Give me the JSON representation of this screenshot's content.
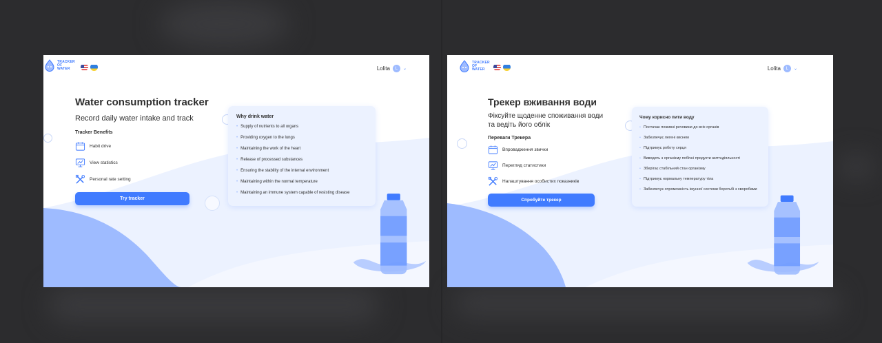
{
  "left_card": {
    "logo": {
      "line1": "TRACKER",
      "line2": "OF WATER"
    },
    "user": {
      "name": "Lolita",
      "avatar_initial": "L"
    },
    "title": "Water consumption tracker",
    "subtitle": "Record daily water intake and track",
    "benefits_title": "Tracker Benefits",
    "benefits": [
      {
        "label": "Habit drive",
        "icon": "calendar-icon"
      },
      {
        "label": "View statistics",
        "icon": "statistics-icon"
      },
      {
        "label": "Personal rate setting",
        "icon": "tools-icon"
      }
    ],
    "button": "Try tracker",
    "panel": {
      "title": "Why drink water",
      "items": [
        "Supply of nutrients to all organs",
        "Providing oxygen to the lungs",
        "Maintaining the work of the heart",
        "Release of processed substances",
        "Ensuring the stability of the internal environment",
        "Maintaining within the normal temperature",
        "Maintaining an immune system capable of resisting disease"
      ]
    }
  },
  "right_card": {
    "logo": {
      "line1": "TRACKER",
      "line2": "OF WATER"
    },
    "user": {
      "name": "Lolita",
      "avatar_initial": "L"
    },
    "title": "Трекер вживання води",
    "subtitle": "Фіксуйте щоденне споживання води та ведіть його облік",
    "benefits_title": "Переваги Трекера",
    "benefits": [
      {
        "label": "Впровадження звички",
        "icon": "calendar-icon"
      },
      {
        "label": "Перегляд статистики",
        "icon": "statistics-icon"
      },
      {
        "label": "Налаштування особистих показників",
        "icon": "tools-icon"
      }
    ],
    "button": "Спробуйте трекер",
    "panel": {
      "title": "Чому корисно пити воду",
      "items": [
        "Постачає поживні речовини до всіх органів",
        "Забезпечує легені киснем",
        "Підтримує роботу серця",
        "Виводить з організму побічні продукти життєдіяльності",
        "Зберігає стабільний стан організму",
        "Підтримує нормальну температуру тіла",
        "Забезпечує спроможність імунної системи боротьбі з хворобами"
      ]
    }
  },
  "colors": {
    "accent": "#407bff",
    "light": "#9ebbff",
    "panel": "#ecf2ff",
    "text": "#2f2f2f",
    "backdrop": "#2c2c2e"
  }
}
